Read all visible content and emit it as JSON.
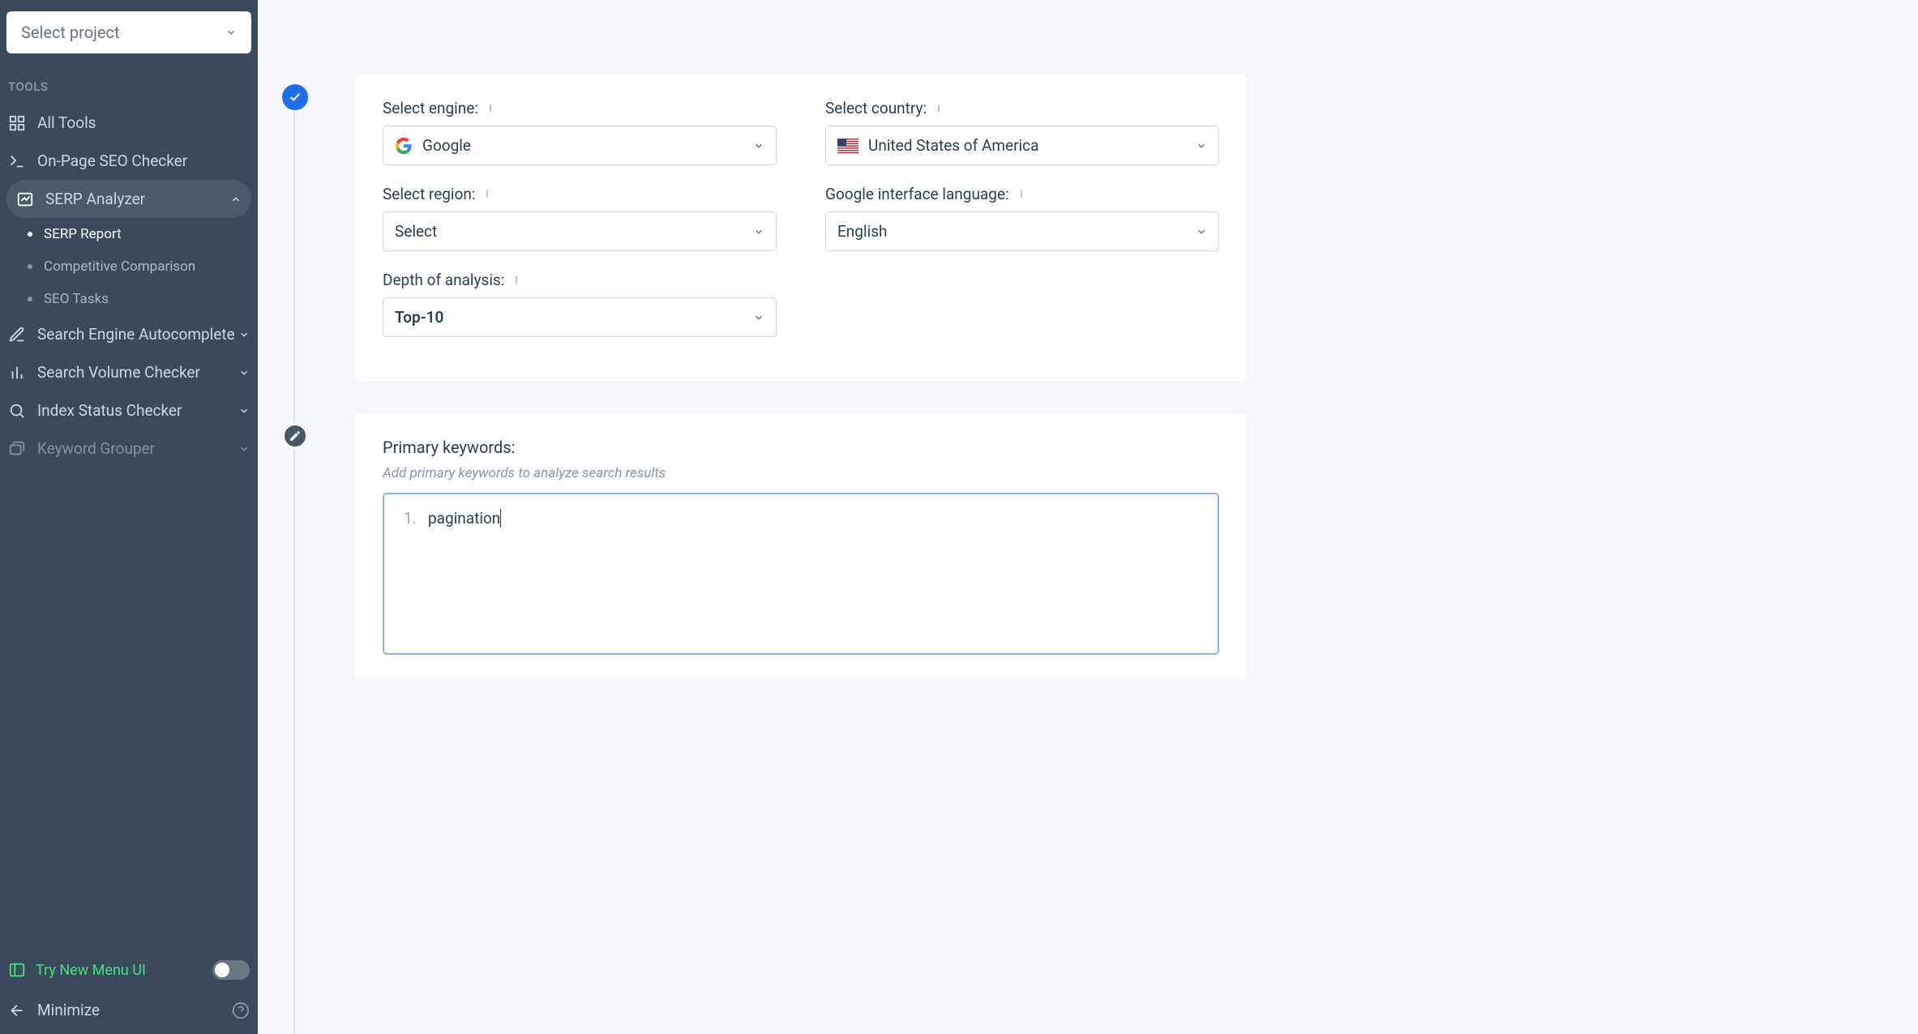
{
  "sidebar": {
    "project_placeholder": "Select project",
    "tools_label": "TOOLS",
    "items": [
      {
        "label": "All Tools",
        "icon": "grid"
      },
      {
        "label": "On-Page SEO Checker",
        "icon": "terminal"
      },
      {
        "label": "SERP Analyzer",
        "icon": "chart-line",
        "active": true,
        "expanded": true,
        "children": [
          {
            "label": "SERP Report",
            "current": true
          },
          {
            "label": "Competitive Comparison"
          },
          {
            "label": "SEO Tasks"
          }
        ]
      },
      {
        "label": "Search Engine Autocomplete",
        "icon": "pencil",
        "expandable": true
      },
      {
        "label": "Search Volume Checker",
        "icon": "bar-chart",
        "expandable": true
      },
      {
        "label": "Index Status Checker",
        "icon": "search",
        "expandable": true
      },
      {
        "label": "Keyword Grouper",
        "icon": "folders",
        "expandable": true,
        "fade": true
      }
    ],
    "try_new": "Try New Menu UI",
    "minimize": "Minimize"
  },
  "form": {
    "engine": {
      "label": "Select engine:",
      "value": "Google"
    },
    "country": {
      "label": "Select country:",
      "value": "United States of America"
    },
    "region": {
      "label": "Select region:",
      "value": "Select"
    },
    "language": {
      "label": "Google interface language:",
      "value": "English"
    },
    "depth": {
      "label": "Depth of analysis:",
      "value": "Top-10"
    },
    "keywords": {
      "label": "Primary keywords:",
      "hint": "Add primary keywords to analyze search results",
      "entries": [
        {
          "num": "1.",
          "text": "pagination"
        }
      ]
    }
  }
}
